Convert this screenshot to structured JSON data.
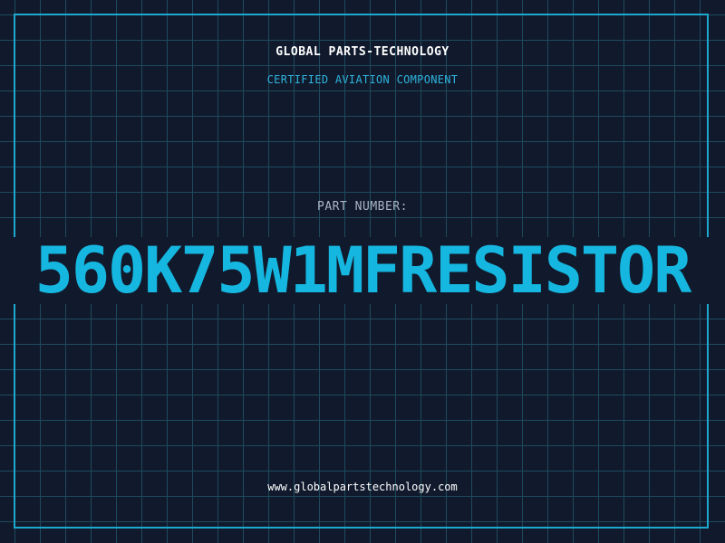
{
  "header": {
    "company_name": "GLOBAL PARTS-TECHNOLOGY",
    "tagline": "CERTIFIED AVIATION COMPONENT"
  },
  "part": {
    "label": "PART NUMBER:",
    "number": "560K75W1MFRESISTOR"
  },
  "footer": {
    "website": "www.globalpartstechnology.com"
  },
  "colors": {
    "background": "#111a2d",
    "grid": "#1e4a5c",
    "accent": "#15b7e0",
    "frame": "#1da8cf",
    "label": "#aab4c4",
    "text": "#ffffff"
  }
}
